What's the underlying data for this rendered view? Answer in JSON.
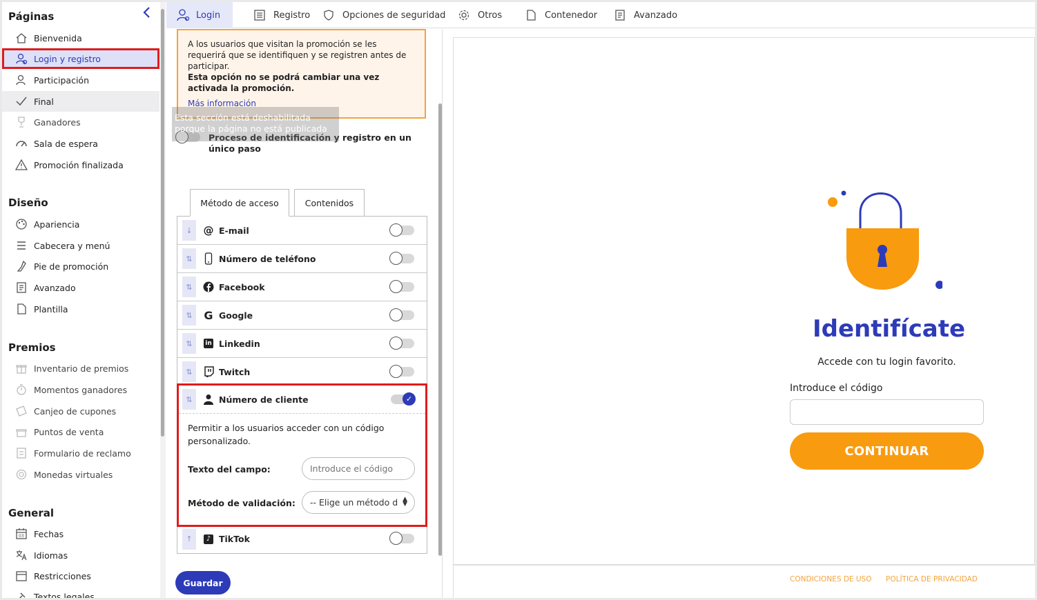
{
  "sidebar": {
    "sections": [
      "Páginas",
      "Diseño",
      "Premios",
      "General"
    ],
    "paginas": [
      "Bienvenida",
      "Login y registro",
      "Participación",
      "Final",
      "Ganadores",
      "Sala de espera",
      "Promoción finalizada"
    ],
    "diseno": [
      "Apariencia",
      "Cabecera y menú",
      "Pie de promoción",
      "Avanzado",
      "Plantilla"
    ],
    "premios": [
      "Inventario de premios",
      "Momentos ganadores",
      "Canjeo de cupones",
      "Puntos de venta",
      "Formulario de reclamo",
      "Monedas virtuales"
    ],
    "general": [
      "Fechas",
      "Idiomas",
      "Restricciones",
      "Textos legales"
    ],
    "tooltip_line1": "Esta sección está deshabilitada",
    "tooltip_line2": "porque la página no está publicada"
  },
  "topbar": {
    "tabs": [
      "Login",
      "Registro",
      "Opciones de seguridad",
      "Otros",
      "Contenedor",
      "Avanzado"
    ]
  },
  "panel": {
    "notice_text": "A los usuarios que visitan la promoción se les requerirá que se identifiquen y se registren antes de participar.",
    "notice_bold": "Esta opción no se podrá cambiar una vez activada la promoción.",
    "notice_link": "Más información",
    "single_step_label": "Proceso de identificación y registro en un único paso",
    "subtabs": [
      "Método de acceso",
      "Contenidos"
    ],
    "methods": [
      "E-mail",
      "Número de teléfono",
      "Facebook",
      "Google",
      "Linkedin",
      "Twitch",
      "Número de cliente",
      "TikTok"
    ],
    "client_desc": "Permitir a los usuarios acceder con un código personalizado.",
    "field_text_label": "Texto del campo:",
    "field_text_placeholder": "Introduce el código",
    "validation_label": "Método de validación:",
    "validation_value": "-- Elige un método d",
    "save_label": "Guardar"
  },
  "preview": {
    "title": "Identifícate",
    "subtitle": "Accede con tu login favorito.",
    "input_label": "Introduce el código",
    "button": "CONTINUAR",
    "footer_terms": "CONDICIONES DE USO",
    "footer_privacy": "POLÍTICA DE PRIVACIDAD"
  },
  "colors": {
    "accent": "#2d3bb8",
    "brand_orange": "#f89b0f",
    "highlight": "#e01b1b"
  }
}
